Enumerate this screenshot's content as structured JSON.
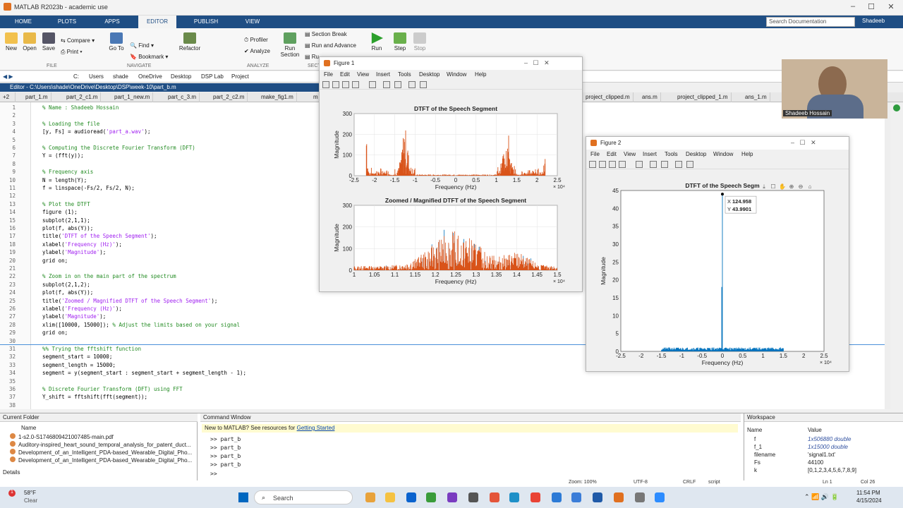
{
  "window": {
    "title": "MATLAB R2023b - academic use"
  },
  "tabs": [
    "HOME",
    "PLOTS",
    "APPS",
    "EDITOR",
    "PUBLISH",
    "VIEW"
  ],
  "search": {
    "placeholder": "Search Documentation"
  },
  "user": "Shadeeb",
  "ribbon": {
    "new": "New",
    "open": "Open",
    "save": "Save",
    "compare": "Compare",
    "print": "Print",
    "goto": "Go To",
    "find": "Find",
    "bookmark": "Bookmark",
    "refactor": "Refactor",
    "profiler": "Profiler",
    "analyze": "Analyze",
    "run_section": "Run Section",
    "section_break": "Section Break",
    "run_advance": "Run and Advance",
    "run_to_end": "Ru",
    "run": "Run",
    "step": "Step",
    "stop": "Stop",
    "grp_file": "FILE",
    "grp_navigate": "NAVIGATE",
    "grp_analyze": "ANALYZE",
    "grp_sect": "SECT"
  },
  "address": [
    "C:",
    "Users",
    "shade",
    "OneDrive",
    "Desktop",
    "DSP Lab",
    "Project"
  ],
  "editor": {
    "header": "Editor - C:\\Users\\shade\\OneDrive\\Desktop\\DSP\\week-10\\part_b.m",
    "line_no": "+2",
    "tabs": [
      "part_1.m",
      "part_2_c1.m",
      "part_1_new.m",
      "part_c_3.m",
      "part_2_c2.m",
      "make_fig1.m",
      "m",
      "project_clipped.m",
      "ans.m",
      "project_clipped_1.m",
      "ans_1.m"
    ]
  },
  "code": [
    [
      "1",
      "% Name : Shadeeb Hossain",
      "cm"
    ],
    [
      "2",
      "",
      ""
    ],
    [
      "3",
      "% Loading the file",
      "cm"
    ],
    [
      "4",
      "[y, Fs] = audioread('part_a.wav');",
      ""
    ],
    [
      "5",
      "",
      ""
    ],
    [
      "6",
      "% Computing the Discrete Fourier Transform (DFT)",
      "cm"
    ],
    [
      "7",
      "Y = (fft(y));",
      ""
    ],
    [
      "8",
      "",
      ""
    ],
    [
      "9",
      "% Frequency axis",
      "cm"
    ],
    [
      "10",
      "N = length(Y);",
      ""
    ],
    [
      "11",
      "f = linspace(-Fs/2, Fs/2, N);",
      ""
    ],
    [
      "12",
      "",
      ""
    ],
    [
      "13",
      "% Plot the DTFT",
      "cm"
    ],
    [
      "14",
      "figure (1);",
      ""
    ],
    [
      "15",
      "subplot(2,1,1);",
      ""
    ],
    [
      "16",
      "plot(f, abs(Y));",
      ""
    ],
    [
      "17",
      "title('DTFT of the Speech Segment');",
      ""
    ],
    [
      "18",
      "xlabel('Frequency (Hz)');",
      ""
    ],
    [
      "19",
      "ylabel('Magnitude');",
      ""
    ],
    [
      "20",
      "grid on;",
      ""
    ],
    [
      "21",
      "",
      ""
    ],
    [
      "22",
      "% Zoom in on the main part of the spectrum",
      "cm"
    ],
    [
      "23",
      "subplot(2,1,2);",
      ""
    ],
    [
      "24",
      "plot(f, abs(Y));",
      ""
    ],
    [
      "25",
      "title('Zoomed / Magnified DTFT of the Speech Segment');",
      ""
    ],
    [
      "26",
      "xlabel('Frequency (Hz)');",
      ""
    ],
    [
      "27",
      "ylabel('Magnitude');",
      ""
    ],
    [
      "28",
      "xlim([10000, 15000]); % Adjust the limits based on your signal",
      ""
    ],
    [
      "29",
      "grid on;",
      ""
    ],
    [
      "30",
      "",
      ""
    ],
    [
      "31",
      "%% Trying the fftshift function",
      "cm"
    ],
    [
      "32",
      "segment_start = 10000;",
      ""
    ],
    [
      "33",
      "segment_length = 15000;",
      ""
    ],
    [
      "34",
      "segment = y(segment_start : segment_start + segment_length - 1);",
      ""
    ],
    [
      "35",
      "",
      ""
    ],
    [
      "36",
      "% Discrete Fourier Transform (DFT) using FFT",
      "cm"
    ],
    [
      "37",
      "Y_shift = fftshift(fft(segment));",
      ""
    ],
    [
      "38",
      "",
      ""
    ]
  ],
  "figure1": {
    "title": "Figure 1",
    "menu": [
      "File",
      "Edit",
      "View",
      "Insert",
      "Tools",
      "Desktop",
      "Window",
      "Help"
    ]
  },
  "figure2": {
    "title": "Figure 2",
    "menu": [
      "File",
      "Edit",
      "View",
      "Insert",
      "Tools",
      "Desktop",
      "Window",
      "Help"
    ],
    "datatip_x": "124.958",
    "datatip_y": "43.9901",
    "datatip_xl": "X",
    "datatip_yl": "Y"
  },
  "chart_data": [
    {
      "type": "line",
      "title": "DTFT of the Speech Segment",
      "xlabel": "Frequency (Hz)",
      "ylabel": "Magnitude",
      "x_exponent": "× 10⁴",
      "xlim": [
        -2.5,
        2.5
      ],
      "ylim": [
        0,
        300
      ],
      "xticks": [
        "-2.5",
        "-2",
        "-1.5",
        "-1",
        "-0.5",
        "0",
        "0.5",
        "1",
        "1.5",
        "2",
        "2.5"
      ],
      "yticks": [
        "0",
        "100",
        "200",
        "300"
      ],
      "peaks_x": [
        -2.2,
        -1.25,
        1.25,
        2.2
      ],
      "peaks_y": [
        290,
        230,
        230,
        290
      ],
      "grid": true
    },
    {
      "type": "line",
      "title": "Zoomed / Magnified DTFT of the Speech Segment",
      "xlabel": "Frequency (Hz)",
      "ylabel": "Magnitude",
      "x_exponent": "× 10⁴",
      "xlim": [
        1,
        1.5
      ],
      "ylim": [
        0,
        300
      ],
      "xticks": [
        "1",
        "1.05",
        "1.1",
        "1.15",
        "1.2",
        "1.25",
        "1.3",
        "1.35",
        "1.4",
        "1.45",
        "1.5"
      ],
      "yticks": [
        "0",
        "100",
        "200",
        "300"
      ],
      "grid": true
    },
    {
      "type": "line",
      "title": "DTFT of the Speech Segm",
      "xlabel": "Frequency (Hz)",
      "ylabel": "Magnitude",
      "x_exponent": "× 10⁴",
      "xlim": [
        -2.5,
        2.5
      ],
      "ylim": [
        0,
        45
      ],
      "xticks": [
        "-2.5",
        "-2",
        "-1.5",
        "-1",
        "-0.5",
        "0",
        "0.5",
        "1",
        "1.5",
        "2",
        "2.5"
      ],
      "yticks": [
        "0",
        "5",
        "10",
        "15",
        "20",
        "25",
        "30",
        "35",
        "40",
        "45"
      ],
      "peak": {
        "x": 124.958,
        "y": 43.9901
      },
      "grid": false
    }
  ],
  "current_folder": {
    "title": "Current Folder",
    "col": "Name",
    "files": [
      "1-s2.0-S1746809421007485-main.pdf",
      "Auditory-inspired_heart_sound_temporal_analysis_for_patent_duct...",
      "Development_of_an_Intelligent_PDA-based_Wearable_Digital_Pho...",
      "Development_of_an_Intelligent_PDA-based_Wearable_Digital_Pho..."
    ],
    "details": "Details"
  },
  "command_window": {
    "title": "Command Window",
    "banner": "New to MATLAB? See resources for",
    "link": "Getting Started",
    "history": [
      ">> part_b",
      ">> part_b",
      ">> part_b",
      ">> part_b"
    ],
    "prompt": ">>"
  },
  "workspace": {
    "title": "Workspace",
    "col_name": "Name",
    "col_value": "Value",
    "vars": [
      [
        "f",
        "1x506880 double"
      ],
      [
        "f_1",
        "1x15000 double"
      ],
      [
        "filename",
        "'signal1.txt'"
      ],
      [
        "Fs",
        "44100"
      ],
      [
        "k",
        "[0,1,2,3,4,5,6,7,8,9]"
      ]
    ]
  },
  "statusbar": {
    "zoom": "Zoom: 100%",
    "enc": "UTF-8",
    "eol": "CRLF",
    "type": "script",
    "ln": "Ln 1",
    "col": "Col 26"
  },
  "webcam": {
    "name": "Shadeeb Hossain"
  },
  "taskbar": {
    "weather": "58°F",
    "cond": "Clear",
    "search": "Search",
    "time": "11:54 PM",
    "date": "4/15/2024",
    "badge": "1"
  }
}
